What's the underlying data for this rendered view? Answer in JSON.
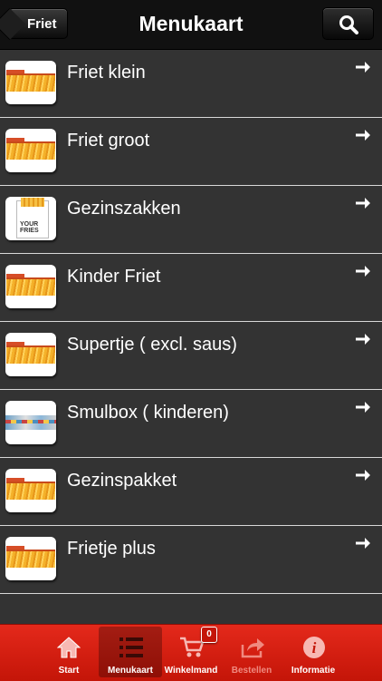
{
  "header": {
    "back_label": "Friet",
    "title": "Menukaart"
  },
  "items": [
    {
      "label": "Friet klein",
      "thumb": "fries"
    },
    {
      "label": "Friet groot",
      "thumb": "fries"
    },
    {
      "label": "Gezinszakken",
      "thumb": "fries-bag",
      "thumb_text": "YOUR FRIES"
    },
    {
      "label": "Kinder Friet",
      "thumb": "fries"
    },
    {
      "label": "Supertje ( excl. saus)",
      "thumb": "fries"
    },
    {
      "label": "Smulbox ( kinderen)",
      "thumb": "snack-box"
    },
    {
      "label": "Gezinspakket",
      "thumb": "fries"
    },
    {
      "label": "Frietje plus",
      "thumb": "fries"
    }
  ],
  "tabbar": {
    "tabs": [
      {
        "label": "Start",
        "icon": "home-icon"
      },
      {
        "label": "Menukaart",
        "icon": "list-icon",
        "active": true
      },
      {
        "label": "Winkelmand",
        "icon": "cart-icon",
        "badge": "0"
      },
      {
        "label": "Bestellen",
        "icon": "share-icon",
        "disabled": true
      },
      {
        "label": "Informatie",
        "icon": "info-icon"
      }
    ]
  },
  "colors": {
    "header_bg": "#111111",
    "list_bg": "#333333",
    "tabbar_red": "#d61f12",
    "divider": "#d8d8d8"
  }
}
